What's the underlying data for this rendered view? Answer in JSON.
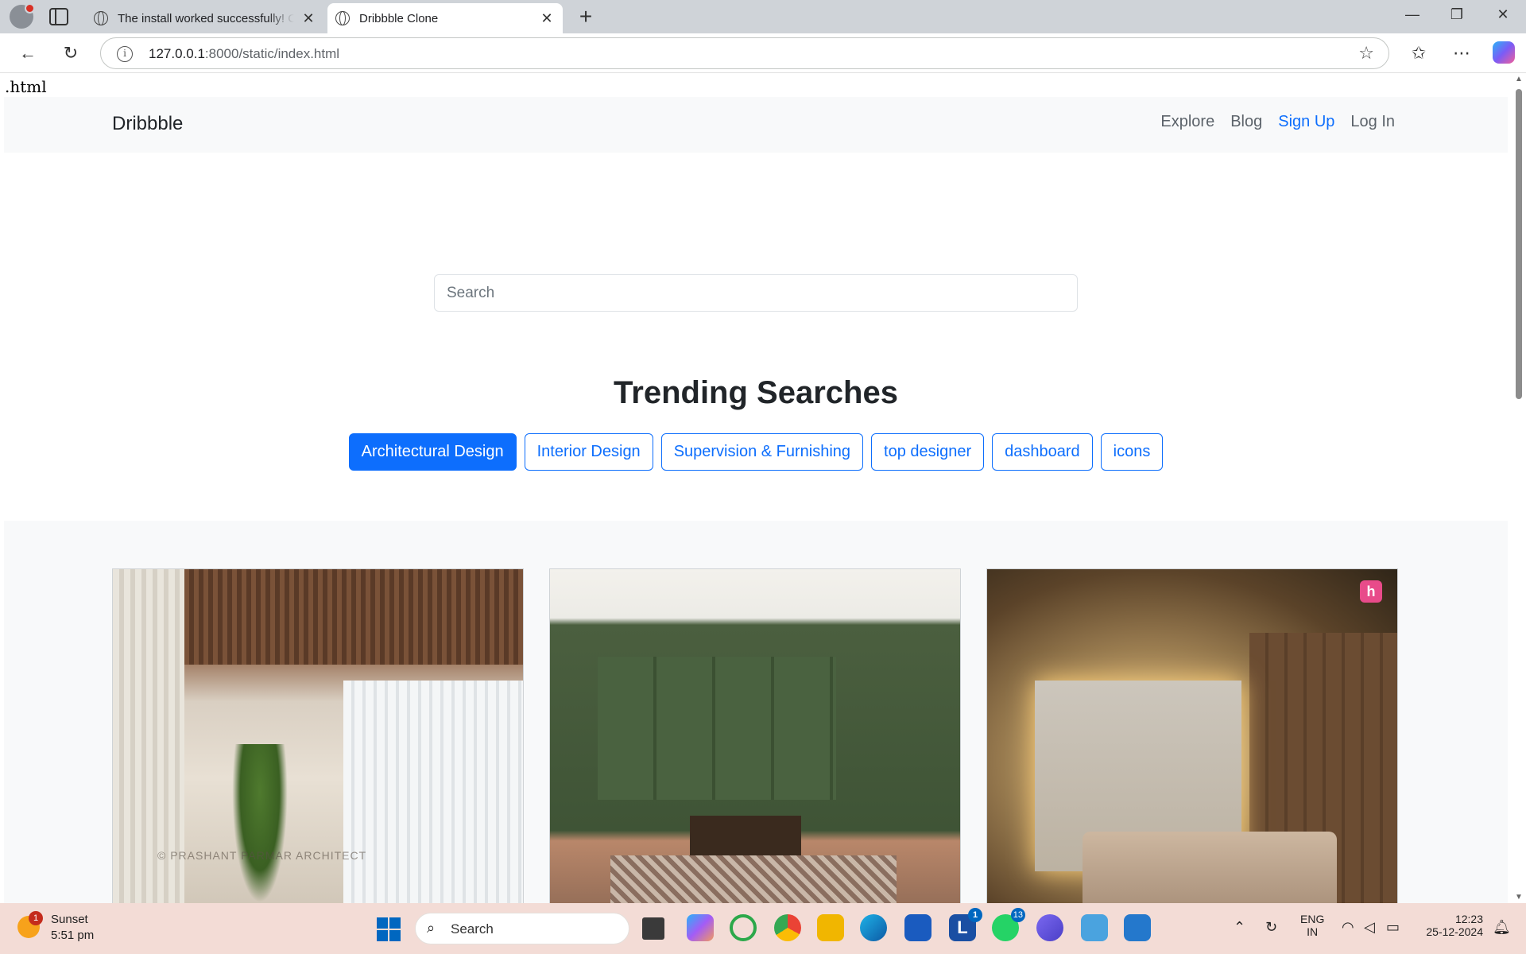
{
  "browser": {
    "tabs": [
      {
        "title": "The install worked successfully! Co"
      },
      {
        "title": "Dribbble Clone"
      }
    ],
    "url_host": "127.0.0.1",
    "url_rest": ":8000/static/index.html"
  },
  "page": {
    "stray_text": ".html",
    "brand": "Dribbble",
    "nav": {
      "explore": "Explore",
      "blog": "Blog",
      "signup": "Sign Up",
      "login": "Log In"
    },
    "search": {
      "placeholder": "Search"
    },
    "trending_title": "Trending Searches",
    "trending_tags": [
      {
        "label": "Architectural Design",
        "active": true
      },
      {
        "label": "Interior Design"
      },
      {
        "label": "Supervision & Furnishing"
      },
      {
        "label": "top designer"
      },
      {
        "label": "dashboard"
      },
      {
        "label": "icons"
      }
    ],
    "shots": {
      "card1_watermark": "© PRASHANT PARMAR ARCHITECT",
      "card3_logo": "h"
    }
  },
  "taskbar": {
    "weather": {
      "badge": "1",
      "title": "Sunset",
      "time": "5:51 pm"
    },
    "search_label": "Search",
    "apps": {
      "linkedin_badge": "1",
      "whatsapp_badge": "13"
    },
    "tray": {
      "lang_1": "ENG",
      "lang_2": "IN",
      "clock_time": "12:23",
      "clock_date": "25-12-2024"
    }
  },
  "colors": {
    "primary": "#0d6efd",
    "navbar_bg": "#f8f9fa",
    "taskbar_bg": "#f3dcd6"
  }
}
